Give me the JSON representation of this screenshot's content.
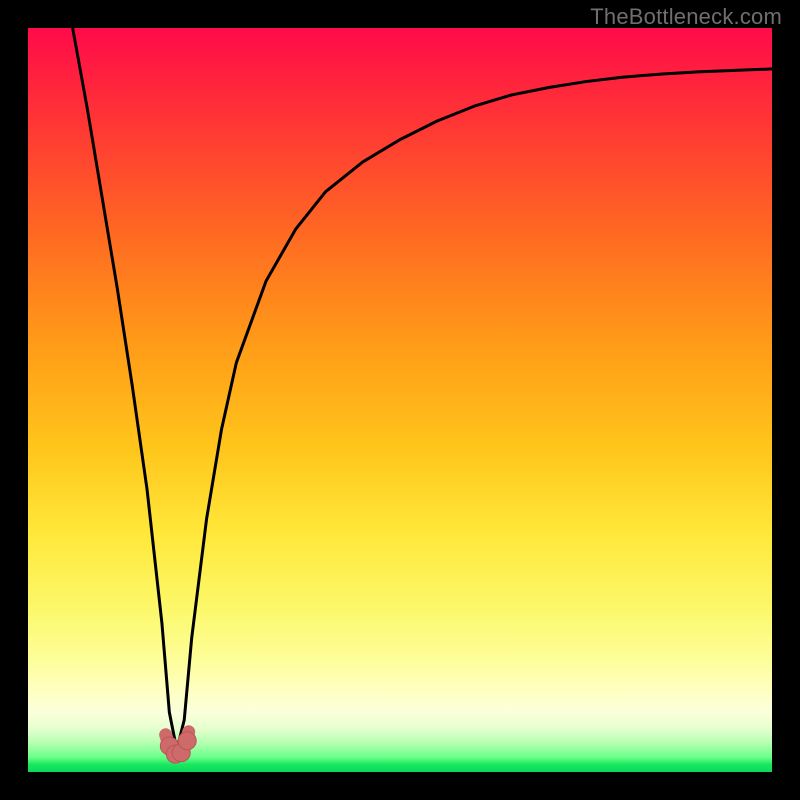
{
  "watermark": {
    "text": "TheBottleneck.com"
  },
  "colors": {
    "frame": "#000000",
    "curve_stroke": "#000000",
    "marker_fill": "#cf6a6a",
    "marker_stroke": "#b85656",
    "gradient_top": "#ff0a4a",
    "gradient_bottom": "#09d85a"
  },
  "chart_data": {
    "type": "line",
    "title": "",
    "xlabel": "",
    "ylabel": "",
    "xlim": [
      0,
      100
    ],
    "ylim": [
      0,
      100
    ],
    "grid": false,
    "legend": false,
    "note": "Y is read as distance from the bottom green band (0) to the top red edge (100). Values estimated from pixel positions; no axis ticks are shown.",
    "series": [
      {
        "name": "bottleneck-curve",
        "x": [
          6,
          8,
          10,
          12,
          14,
          16,
          18,
          19,
          20,
          21,
          22,
          24,
          26,
          28,
          32,
          36,
          40,
          45,
          50,
          55,
          60,
          65,
          70,
          75,
          80,
          85,
          90,
          95,
          100
        ],
        "y": [
          100,
          89,
          77,
          65,
          52,
          38,
          20,
          8,
          3,
          7,
          18,
          34,
          46,
          55,
          66,
          73,
          78,
          82,
          85,
          87.5,
          89.5,
          91,
          92,
          92.8,
          93.4,
          93.8,
          94.1,
          94.3,
          94.5
        ]
      }
    ],
    "markers": [
      {
        "name": "min-left",
        "x": 19,
        "y": 3.5
      },
      {
        "name": "min-mid-l",
        "x": 19.8,
        "y": 2.4
      },
      {
        "name": "min-mid-r",
        "x": 20.6,
        "y": 2.6
      },
      {
        "name": "min-right",
        "x": 21.4,
        "y": 4.2
      }
    ],
    "min_stroke": {
      "name": "u-highlight",
      "x": [
        18.5,
        19.2,
        20.0,
        20.8,
        21.6
      ],
      "y": [
        5.0,
        2.8,
        2.2,
        2.9,
        5.4
      ]
    }
  }
}
